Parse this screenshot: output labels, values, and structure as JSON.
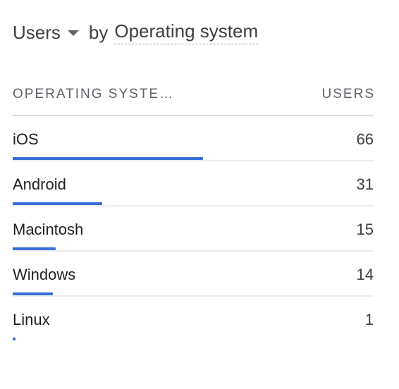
{
  "header": {
    "metric_label": "Users",
    "by_label": "by",
    "dimension_label": "Operating system"
  },
  "table": {
    "columns": {
      "dimension": "OPERATING SYSTE…",
      "metric": "USERS"
    },
    "bar_color": "#3b6fd9",
    "rows": [
      {
        "label": "iOS",
        "value": 66
      },
      {
        "label": "Android",
        "value": 31
      },
      {
        "label": "Macintosh",
        "value": 15
      },
      {
        "label": "Windows",
        "value": 14
      },
      {
        "label": "Linux",
        "value": 1
      }
    ]
  }
}
